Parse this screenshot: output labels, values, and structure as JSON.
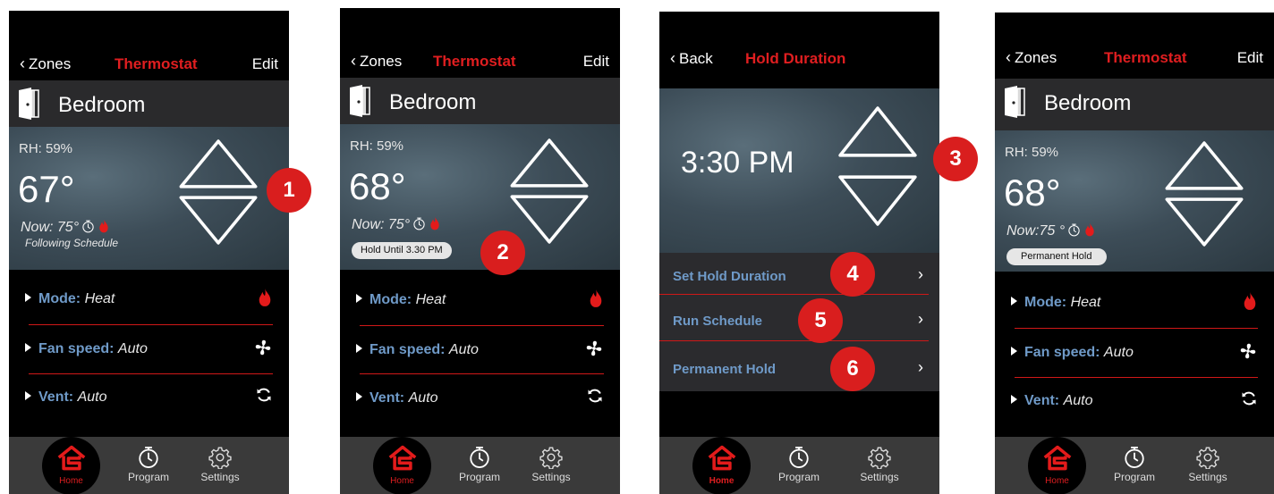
{
  "screens": [
    {
      "header": {
        "back": "Zones",
        "title": "Thermostat",
        "edit": "Edit"
      },
      "room": "Bedroom",
      "rh": "RH: 59%",
      "temp": "67°",
      "now": "Now: 75°",
      "status": "Following  Schedule",
      "rows": [
        {
          "label": "Mode:",
          "value": "Heat"
        },
        {
          "label": "Fan speed:",
          "value": "Auto"
        },
        {
          "label": "Vent:",
          "value": "Auto"
        }
      ],
      "nav": {
        "home": "Home",
        "program": "Program",
        "settings": "Settings"
      },
      "badge": "1"
    },
    {
      "header": {
        "back": "Zones",
        "title": "Thermostat",
        "edit": "Edit"
      },
      "room": "Bedroom",
      "rh": "RH: 59%",
      "temp": "68°",
      "now": "Now:  75°",
      "pill": "Hold Until 3.30 PM",
      "rows": [
        {
          "label": "Mode:",
          "value": "Heat"
        },
        {
          "label": "Fan speed:",
          "value": "Auto"
        },
        {
          "label": "Vent:",
          "value": "Auto"
        }
      ],
      "nav": {
        "home": "Home",
        "program": "Program",
        "settings": "Settings"
      },
      "badge": "2"
    },
    {
      "header": {
        "back": "Back",
        "title": "Hold Duration"
      },
      "time": "3:30 PM",
      "options": [
        "Set Hold Duration",
        "Run Schedule",
        "Permanent Hold"
      ],
      "badges": [
        "3",
        "4",
        "5",
        "6"
      ],
      "nav": {
        "home": "Home",
        "program": "Program",
        "settings": "Settings"
      }
    },
    {
      "header": {
        "back": "Zones",
        "title": "Thermostat",
        "edit": "Edit"
      },
      "room": "Bedroom",
      "rh": "RH: 59%",
      "temp": "68°",
      "now": "Now:75 °",
      "pill": "Permanent Hold",
      "rows": [
        {
          "label": "Mode:",
          "value": "Heat"
        },
        {
          "label": "Fan speed:",
          "value": "Auto"
        },
        {
          "label": "Vent:",
          "value": "Auto"
        }
      ],
      "nav": {
        "home": "Home",
        "program": "Program",
        "settings": "Settings"
      }
    }
  ]
}
